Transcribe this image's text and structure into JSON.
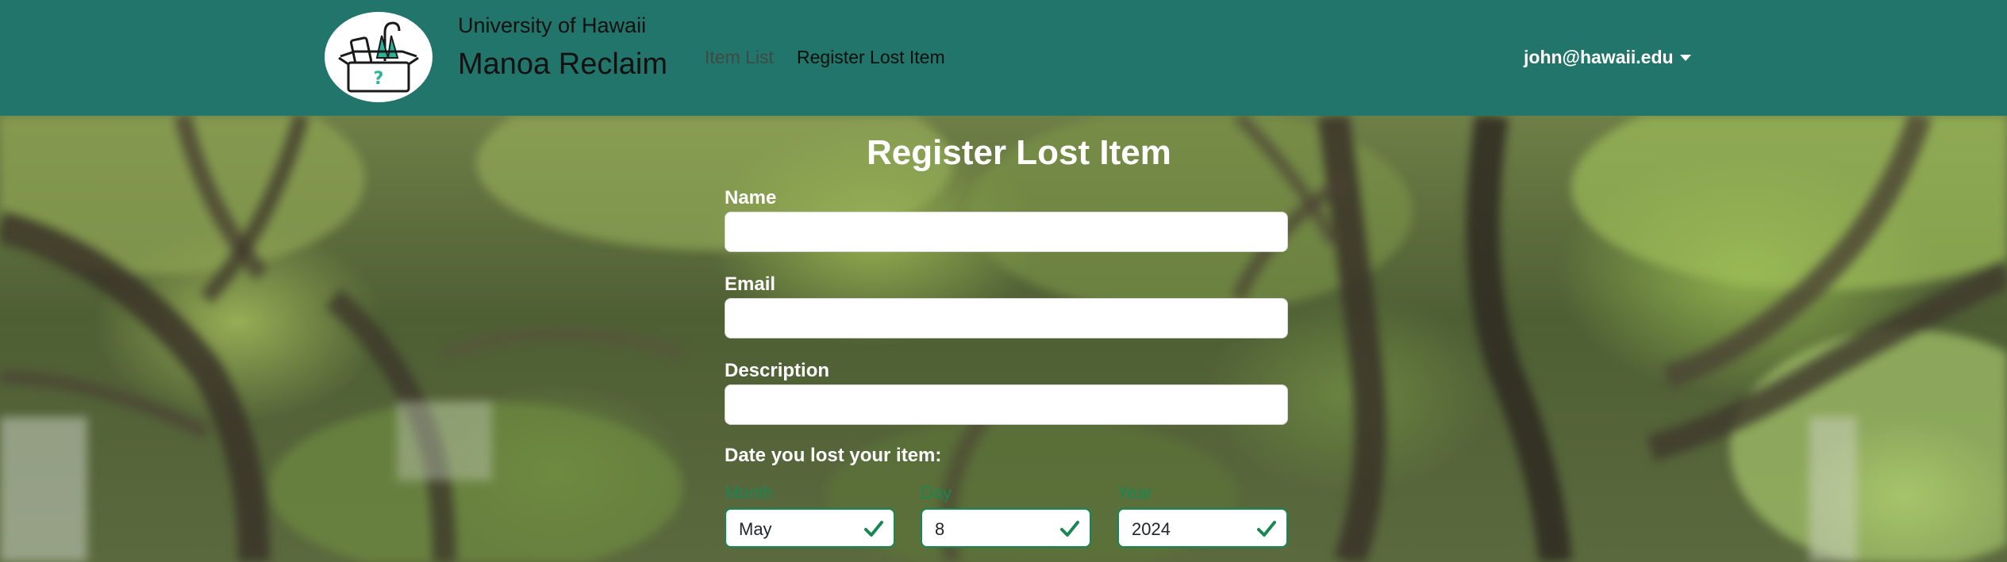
{
  "navbar": {
    "brand_sub": "University of Hawaii",
    "brand_main": "Manoa Reclaim",
    "links": [
      {
        "label": "Item List"
      },
      {
        "label": "Register Lost Item"
      }
    ],
    "user_email": "john@hawaii.edu",
    "background_color": "#22756a"
  },
  "form": {
    "title": "Register Lost Item",
    "name_label": "Name",
    "name_value": "",
    "email_label": "Email",
    "email_value": "",
    "description_label": "Description",
    "description_value": "",
    "date_label": "Date you lost your item:",
    "month_label": "Month",
    "month_value": "May",
    "day_label": "Day",
    "day_value": "8",
    "year_label": "Year",
    "year_value": "2024",
    "valid_color": "#198754"
  },
  "icons": {
    "logo": "lost-and-found-box-icon",
    "valid": "checkmark-icon",
    "dropdown": "caret-down-icon"
  }
}
